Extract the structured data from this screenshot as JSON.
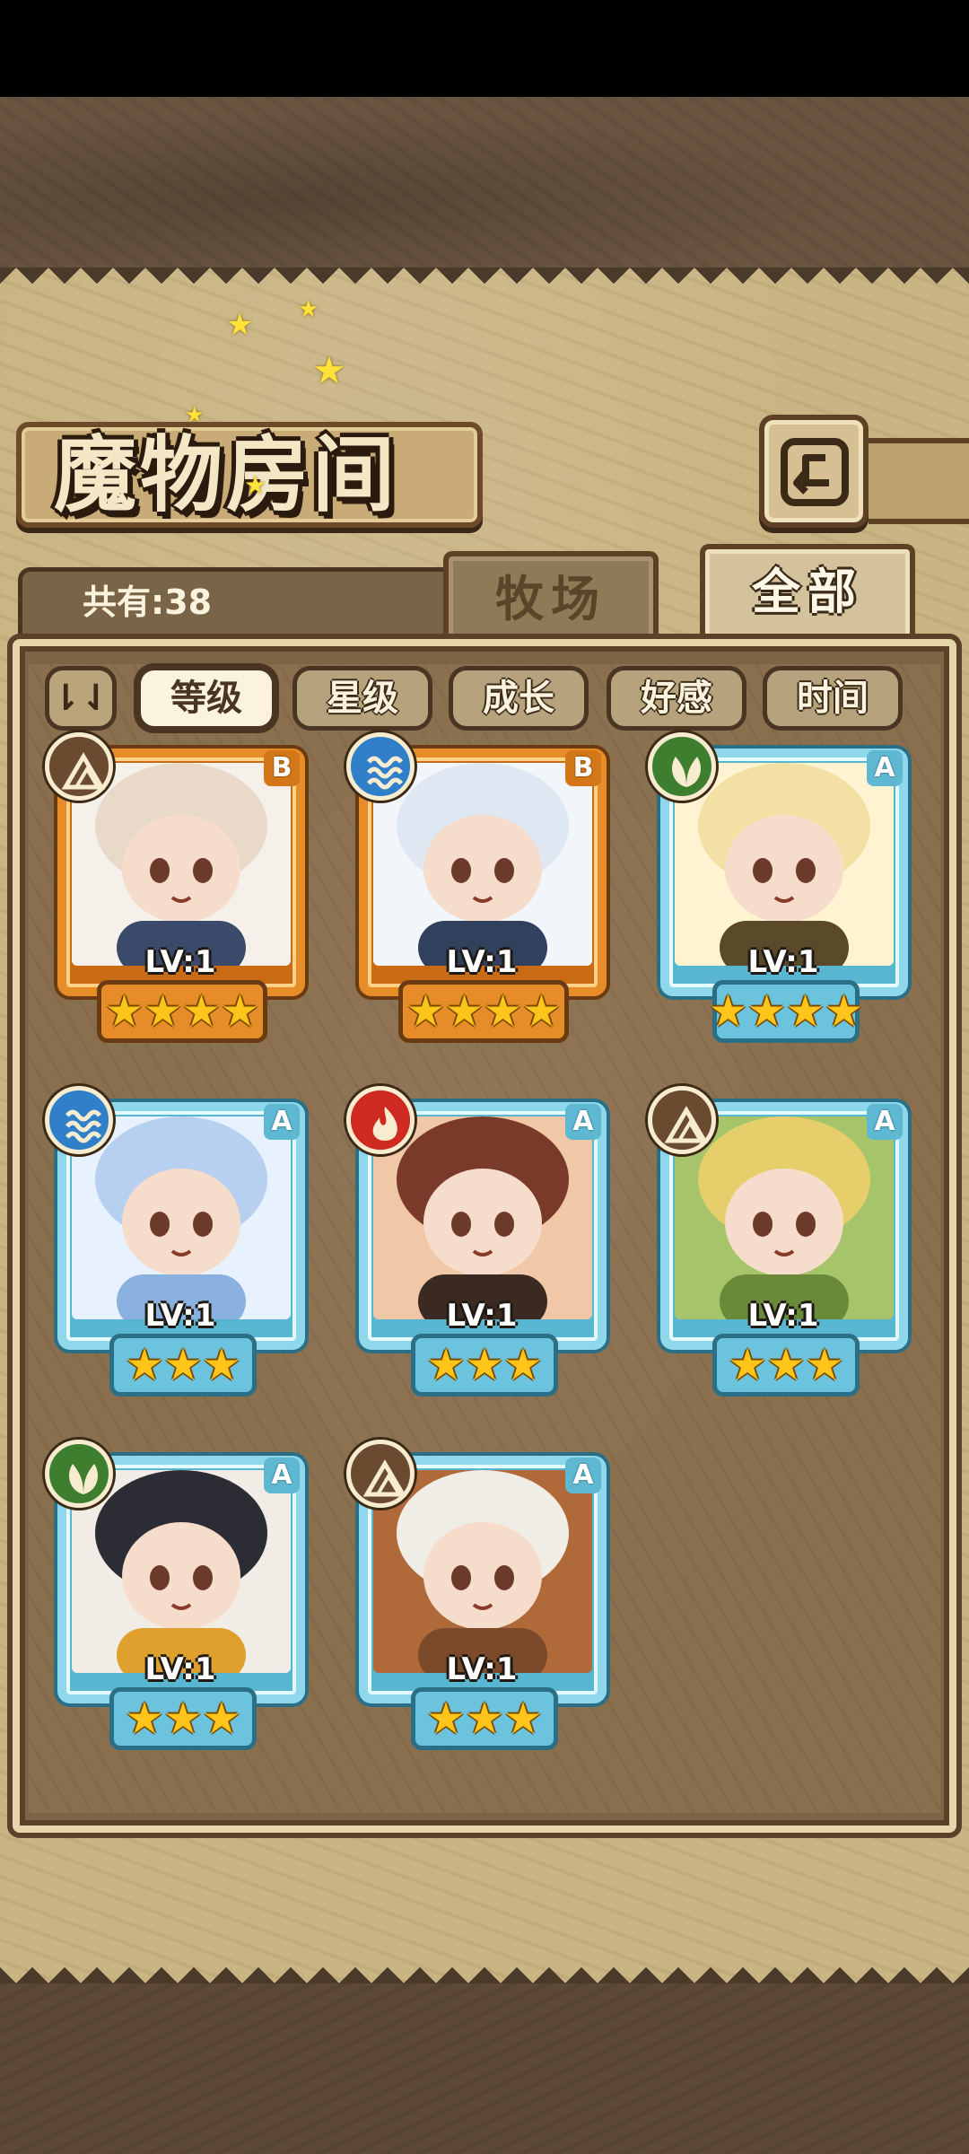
{
  "header": {
    "title": "魔物房间",
    "count_label": "共有:38"
  },
  "tabs": [
    {
      "label": "牧场",
      "active": false
    },
    {
      "label": "全部",
      "active": true
    }
  ],
  "sort": {
    "toggle_icon": "sort-order-icon",
    "toggle_glyph": "⇂⇃",
    "options": [
      {
        "label": "等级",
        "active": true
      },
      {
        "label": "星级",
        "active": false
      },
      {
        "label": "成长",
        "active": false
      },
      {
        "label": "好感",
        "active": false
      },
      {
        "label": "时间",
        "active": false
      }
    ]
  },
  "monsters": [
    {
      "rank": "B",
      "element": "earth",
      "level": "LV:1",
      "stars": 4
    },
    {
      "rank": "B",
      "element": "water",
      "level": "LV:1",
      "stars": 4
    },
    {
      "rank": "A",
      "element": "wood",
      "level": "LV:1",
      "stars": 4
    },
    {
      "rank": "A",
      "element": "water",
      "level": "LV:1",
      "stars": 3
    },
    {
      "rank": "A",
      "element": "fire",
      "level": "LV:1",
      "stars": 3
    },
    {
      "rank": "A",
      "element": "earth",
      "level": "LV:1",
      "stars": 3
    },
    {
      "rank": "A",
      "element": "wood",
      "level": "LV:1",
      "stars": 3
    },
    {
      "rank": "A",
      "element": "earth",
      "level": "LV:1",
      "stars": 3
    }
  ],
  "colors": {
    "rank_B": "#e68d2a",
    "rank_A": "#8fd7ea",
    "earth": "#6b4b30",
    "water": "#2f7fc9",
    "fire": "#cf2a22",
    "wood": "#3d7f2e"
  }
}
